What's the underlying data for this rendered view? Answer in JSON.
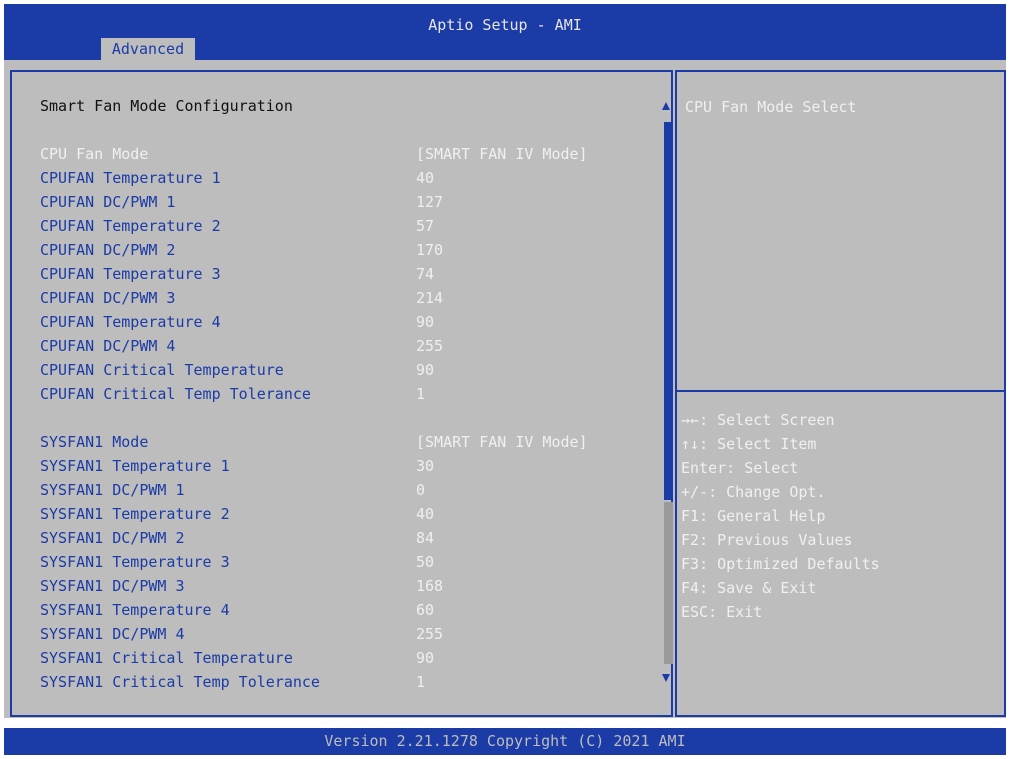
{
  "app_title": "Aptio Setup - AMI",
  "active_tab": "Advanced",
  "section_title": "Smart Fan Mode Configuration",
  "cpu_fan": {
    "mode": {
      "label": "CPU Fan Mode",
      "value": "[SMART FAN IV Mode]"
    },
    "rows": [
      {
        "label": "CPUFAN Temperature 1",
        "value": "40"
      },
      {
        "label": "CPUFAN DC/PWM 1",
        "value": "127"
      },
      {
        "label": "CPUFAN Temperature 2",
        "value": "57"
      },
      {
        "label": "CPUFAN DC/PWM 2",
        "value": "170"
      },
      {
        "label": "CPUFAN Temperature 3",
        "value": "74"
      },
      {
        "label": "CPUFAN DC/PWM 3",
        "value": "214"
      },
      {
        "label": "CPUFAN Temperature 4",
        "value": "90"
      },
      {
        "label": "CPUFAN DC/PWM 4",
        "value": "255"
      },
      {
        "label": "CPUFAN Critical Temperature",
        "value": "90"
      },
      {
        "label": "CPUFAN Critical Temp Tolerance",
        "value": "1"
      }
    ]
  },
  "sys_fan": {
    "mode": {
      "label": "SYSFAN1 Mode",
      "value": "[SMART FAN IV Mode]"
    },
    "rows": [
      {
        "label": "SYSFAN1 Temperature 1",
        "value": "30"
      },
      {
        "label": "SYSFAN1 DC/PWM 1",
        "value": "0"
      },
      {
        "label": "SYSFAN1 Temperature 2",
        "value": "40"
      },
      {
        "label": "SYSFAN1 DC/PWM 2",
        "value": "84"
      },
      {
        "label": "SYSFAN1 Temperature 3",
        "value": "50"
      },
      {
        "label": "SYSFAN1 DC/PWM 3",
        "value": "168"
      },
      {
        "label": "SYSFAN1 Temperature 4",
        "value": "60"
      },
      {
        "label": "SYSFAN1 DC/PWM 4",
        "value": "255"
      },
      {
        "label": "SYSFAN1 Critical Temperature",
        "value": "90"
      },
      {
        "label": "SYSFAN1 Critical Temp Tolerance",
        "value": "1"
      }
    ]
  },
  "help": {
    "title": "CPU Fan Mode Select",
    "keys": [
      {
        "key": "→←",
        "desc": ": Select Screen"
      },
      {
        "key": "↑↓",
        "desc": ": Select Item"
      },
      {
        "key": "Enter",
        "desc": ": Select"
      },
      {
        "key": "+/-",
        "desc": ": Change Opt."
      },
      {
        "key": "F1",
        "desc": ": General Help"
      },
      {
        "key": "F2",
        "desc": ": Previous Values"
      },
      {
        "key": "F3",
        "desc": ": Optimized Defaults"
      },
      {
        "key": "F4",
        "desc": ": Save & Exit"
      },
      {
        "key": "ESC",
        "desc": ": Exit"
      }
    ]
  },
  "footer": "Version 2.21.1278 Copyright (C) 2021 AMI",
  "colors": {
    "accent": "#1b3ba6",
    "background": "#bdbdbd",
    "text_light": "#f0f0f0"
  }
}
